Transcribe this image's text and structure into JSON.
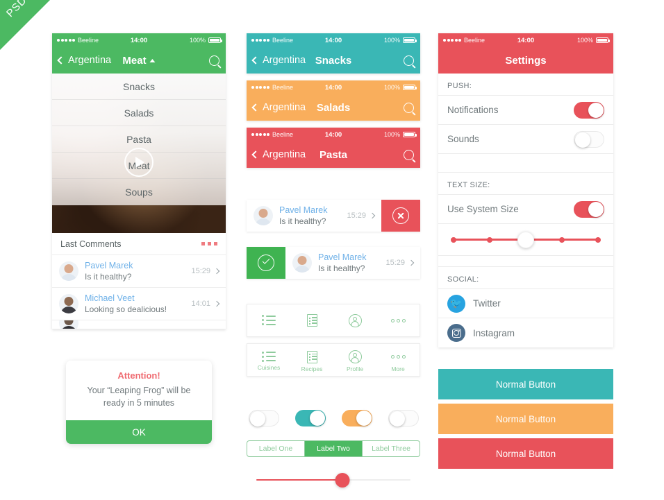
{
  "ribbon": {
    "label": "PSD"
  },
  "colors": {
    "green": "#4cb962",
    "teal": "#3ab7b5",
    "orange": "#f9ae5c",
    "red": "#e8525a",
    "link_blue": "#6fb1e8",
    "twitter_blue": "#27a3e0",
    "instagram_blue": "#4a6d8c"
  },
  "statusbar": {
    "carrier": "Beeline",
    "time": "14:00",
    "battery": "100%"
  },
  "phone1": {
    "nav": {
      "back": "Argentina",
      "title": "Meat",
      "caret": "up-caret-icon",
      "search": "search-icon"
    },
    "dropdown": {
      "items": [
        "Snacks",
        "Salads",
        "Pasta",
        "Meat",
        "Soups"
      ]
    },
    "media": {
      "play": "play-icon"
    },
    "comments_header": {
      "title": "Last Comments",
      "more": "more-dots-icon"
    },
    "comments": [
      {
        "name": "Pavel Marek",
        "text": "Is it healthy?",
        "time": "15:29"
      },
      {
        "name": "Michael Veet",
        "text": "Looking so dealicious!",
        "time": "14:01"
      }
    ]
  },
  "phone2": {
    "navbars": [
      {
        "back": "Argentina",
        "title": "Snacks",
        "color": "#3ab7b5"
      },
      {
        "back": "Argentina",
        "title": "Salads",
        "color": "#f9ae5c"
      },
      {
        "back": "Argentina",
        "title": "Pasta",
        "color": "#e8525a"
      }
    ],
    "swipe_rows": [
      {
        "name": "Pavel Marek",
        "text": "Is it healthy?",
        "time": "15:29",
        "action": "delete",
        "action_icon": "close-circle-icon",
        "side": "right"
      },
      {
        "name": "Pavel Marek",
        "text": "Is it healthy?",
        "time": "15:29",
        "action": "confirm",
        "action_icon": "check-circle-icon",
        "side": "left"
      }
    ],
    "tabbar": [
      {
        "label": "Cuisines",
        "icon": "list-icon"
      },
      {
        "label": "Recipes",
        "icon": "document-icon"
      },
      {
        "label": "Profile",
        "icon": "profile-icon"
      },
      {
        "label": "More",
        "icon": "more-icon"
      }
    ]
  },
  "phone3": {
    "nav": {
      "title": "Settings"
    },
    "sections": [
      {
        "header": "PUSH:",
        "rows": [
          {
            "label": "Notifications",
            "toggle": "on"
          },
          {
            "label": "Sounds",
            "toggle": "off"
          }
        ]
      },
      {
        "header": "TEXT SIZE:",
        "rows": [
          {
            "label": "Use System Size",
            "toggle": "on"
          }
        ],
        "slider": {
          "steps": 5,
          "value": 3
        }
      },
      {
        "header": "SOCIAL:",
        "rows": [
          {
            "label": "Twitter",
            "icon": "twitter-icon"
          },
          {
            "label": "Instagram",
            "icon": "instagram-icon"
          }
        ]
      }
    ]
  },
  "alert": {
    "title": "Attention!",
    "line1": "Your “Leaping Frog” will be",
    "line2": "ready in 5 minutes",
    "ok": "OK"
  },
  "controls": {
    "toggles": [
      {
        "state": "off",
        "color": "#ffffff"
      },
      {
        "state": "on",
        "color": "#3ab7b5"
      },
      {
        "state": "on",
        "color": "#f9ae5c"
      },
      {
        "state": "off",
        "color": "#ffffff"
      }
    ],
    "segmented": {
      "items": [
        "Label One",
        "Label Two",
        "Label Three"
      ],
      "active_index": 1
    },
    "slider": {
      "value": 55
    }
  },
  "buttons": [
    {
      "label": "Normal Button",
      "color": "#3ab7b5"
    },
    {
      "label": "Normal Button",
      "color": "#f9ae5c"
    },
    {
      "label": "Normal Button",
      "color": "#e8525a"
    }
  ]
}
